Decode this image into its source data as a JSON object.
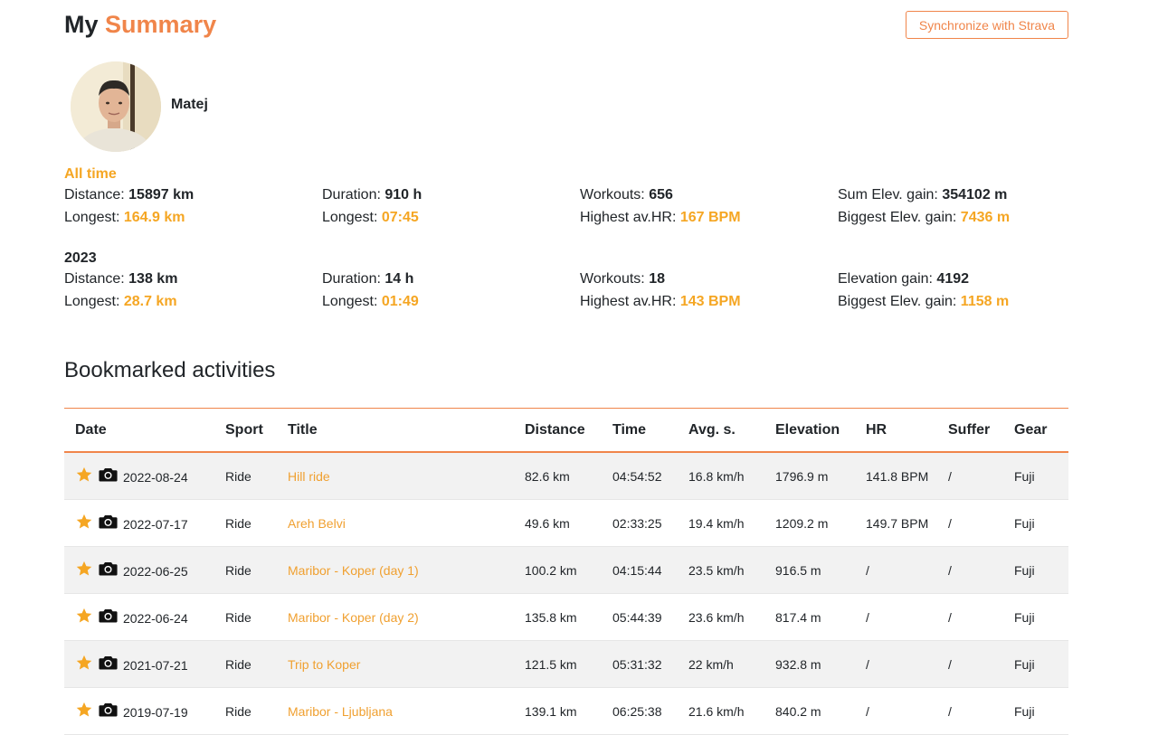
{
  "header": {
    "title_prefix": "My",
    "title_accent": "Summary",
    "sync_button": "Synchronize with Strava"
  },
  "profile": {
    "name": "Matej"
  },
  "stats_all_time": {
    "label": "All time",
    "distance_label": "Distance:",
    "distance": "15897 km",
    "duration_label": "Duration:",
    "duration": "910 h",
    "workouts_label": "Workouts:",
    "workouts": "656",
    "elev_label": "Sum Elev. gain:",
    "elev": "354102 m",
    "longest_dist_label": "Longest:",
    "longest_dist": "164.9 km",
    "longest_dur_label": "Longest:",
    "longest_dur": "07:45",
    "highest_hr_label": "Highest av.HR:",
    "highest_hr": "167 BPM",
    "biggest_elev_label": "Biggest Elev. gain:",
    "biggest_elev": "7436 m"
  },
  "stats_year": {
    "label": "2023",
    "distance_label": "Distance:",
    "distance": "138 km",
    "duration_label": "Duration:",
    "duration": "14 h",
    "workouts_label": "Workouts:",
    "workouts": "18",
    "elev_label": "Elevation gain:",
    "elev": "4192",
    "longest_dist_label": "Longest:",
    "longest_dist": "28.7 km",
    "longest_dur_label": "Longest:",
    "longest_dur": "01:49",
    "highest_hr_label": "Highest av.HR:",
    "highest_hr": "143 BPM",
    "biggest_elev_label": "Biggest Elev. gain:",
    "biggest_elev": "1158 m"
  },
  "bookmarks": {
    "title": "Bookmarked activities",
    "columns": [
      "Date",
      "Sport",
      "Title",
      "Distance",
      "Time",
      "Avg. s.",
      "Elevation",
      "HR",
      "Suffer",
      "Gear"
    ],
    "rows": [
      {
        "date": "2022-08-24",
        "sport": "Ride",
        "title": "Hill ride",
        "distance": "82.6 km",
        "time": "04:54:52",
        "avg": "16.8 km/h",
        "elevation": "1796.9 m",
        "hr": "141.8 BPM",
        "suffer": "/",
        "gear": "Fuji"
      },
      {
        "date": "2022-07-17",
        "sport": "Ride",
        "title": "Areh Belvi",
        "distance": "49.6 km",
        "time": "02:33:25",
        "avg": "19.4 km/h",
        "elevation": "1209.2 m",
        "hr": "149.7 BPM",
        "suffer": "/",
        "gear": "Fuji"
      },
      {
        "date": "2022-06-25",
        "sport": "Ride",
        "title": "Maribor - Koper (day 1)",
        "distance": "100.2 km",
        "time": "04:15:44",
        "avg": "23.5 km/h",
        "elevation": "916.5 m",
        "hr": "/",
        "suffer": "/",
        "gear": "Fuji"
      },
      {
        "date": "2022-06-24",
        "sport": "Ride",
        "title": "Maribor - Koper (day 2)",
        "distance": "135.8 km",
        "time": "05:44:39",
        "avg": "23.6 km/h",
        "elevation": "817.4 m",
        "hr": "/",
        "suffer": "/",
        "gear": "Fuji"
      },
      {
        "date": "2021-07-21",
        "sport": "Ride",
        "title": "Trip to Koper",
        "distance": "121.5 km",
        "time": "05:31:32",
        "avg": "22 km/h",
        "elevation": "932.8 m",
        "hr": "/",
        "suffer": "/",
        "gear": "Fuji"
      },
      {
        "date": "2019-07-19",
        "sport": "Ride",
        "title": "Maribor - Ljubljana",
        "distance": "139.1 km",
        "time": "06:25:38",
        "avg": "21.6 km/h",
        "elevation": "840.2 m",
        "hr": "/",
        "suffer": "/",
        "gear": "Fuji"
      }
    ]
  },
  "icons": {
    "bookmark": "star-icon",
    "photo": "camera-icon"
  },
  "colors": {
    "accent": "#f0854a",
    "highlight": "#f5a623",
    "star": "#f5a623"
  }
}
